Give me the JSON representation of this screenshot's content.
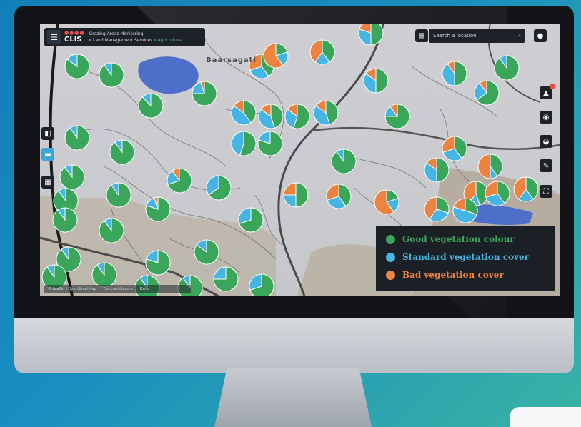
{
  "colors": {
    "good": "#3aa65a",
    "standard": "#45b6e4",
    "bad": "#ee8340",
    "header_bg": "#1c2228"
  },
  "header": {
    "logo": "CLIS",
    "logo_dots": "●●●●",
    "title": "Grazing Areas Monitoring",
    "subtitle_prefix": "» Land Management Services",
    "subtitle_accent": "» Agriculture"
  },
  "search": {
    "placeholder": "Search a location",
    "icon": "search-icon"
  },
  "place_label": "Baarsagatl",
  "left_tools": [
    {
      "name": "layers-icon"
    },
    {
      "name": "folder-icon"
    },
    {
      "name": "grid-icon"
    }
  ],
  "right_tools": [
    {
      "name": "notification-icon"
    },
    {
      "name": "stack-icon"
    },
    {
      "name": "inbox-icon"
    },
    {
      "name": "pencil-icon"
    },
    {
      "name": "fullscreen-icon"
    }
  ],
  "legend": {
    "items": [
      {
        "label": "Good vegetation colour",
        "color": "#3aa65a"
      },
      {
        "label": "Standard vegetation cover",
        "color": "#45b6e4"
      },
      {
        "label": "Bad vegetation cover",
        "color": "#ee8340"
      }
    ]
  },
  "footer": {
    "items": [
      "© Leaflet | OpenStreetMap",
      "Esri contributors",
      "Data"
    ]
  }
}
